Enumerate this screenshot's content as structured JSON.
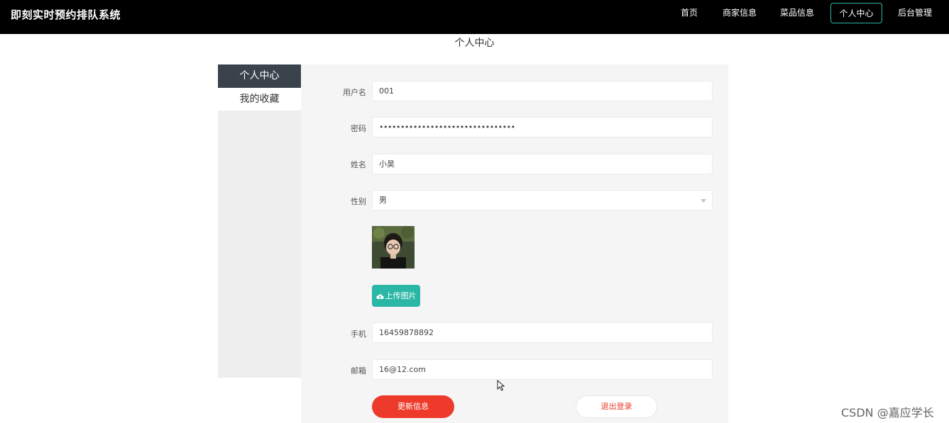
{
  "header": {
    "title": "即刻实时预约排队系统",
    "nav": [
      "首页",
      "商家信息",
      "菜品信息",
      "个人中心",
      "后台管理"
    ],
    "active_nav": "个人中心"
  },
  "page_title": "个人中心",
  "sidebar": {
    "items": [
      "个人中心",
      "我的收藏"
    ],
    "active": "个人中心"
  },
  "form": {
    "username_label": "用户名",
    "username": "001",
    "password_label": "密码",
    "password_masked": "••••••••••••••••••••••••••••••••",
    "name_label": "姓名",
    "name": "小昊",
    "gender_label": "性别",
    "gender": "男",
    "upload_label": "上传图片",
    "phone_label": "手机",
    "phone": "16459878892",
    "email_label": "邮箱",
    "email": "16@12.com"
  },
  "buttons": {
    "update": "更新信息",
    "logout": "退出登录"
  },
  "watermark": "CSDN @嘉应学长",
  "colors": {
    "accent": "#2bb7a6",
    "danger": "#ee3a2a",
    "sidebar_active": "#3a434c",
    "topbar": "#000000"
  }
}
